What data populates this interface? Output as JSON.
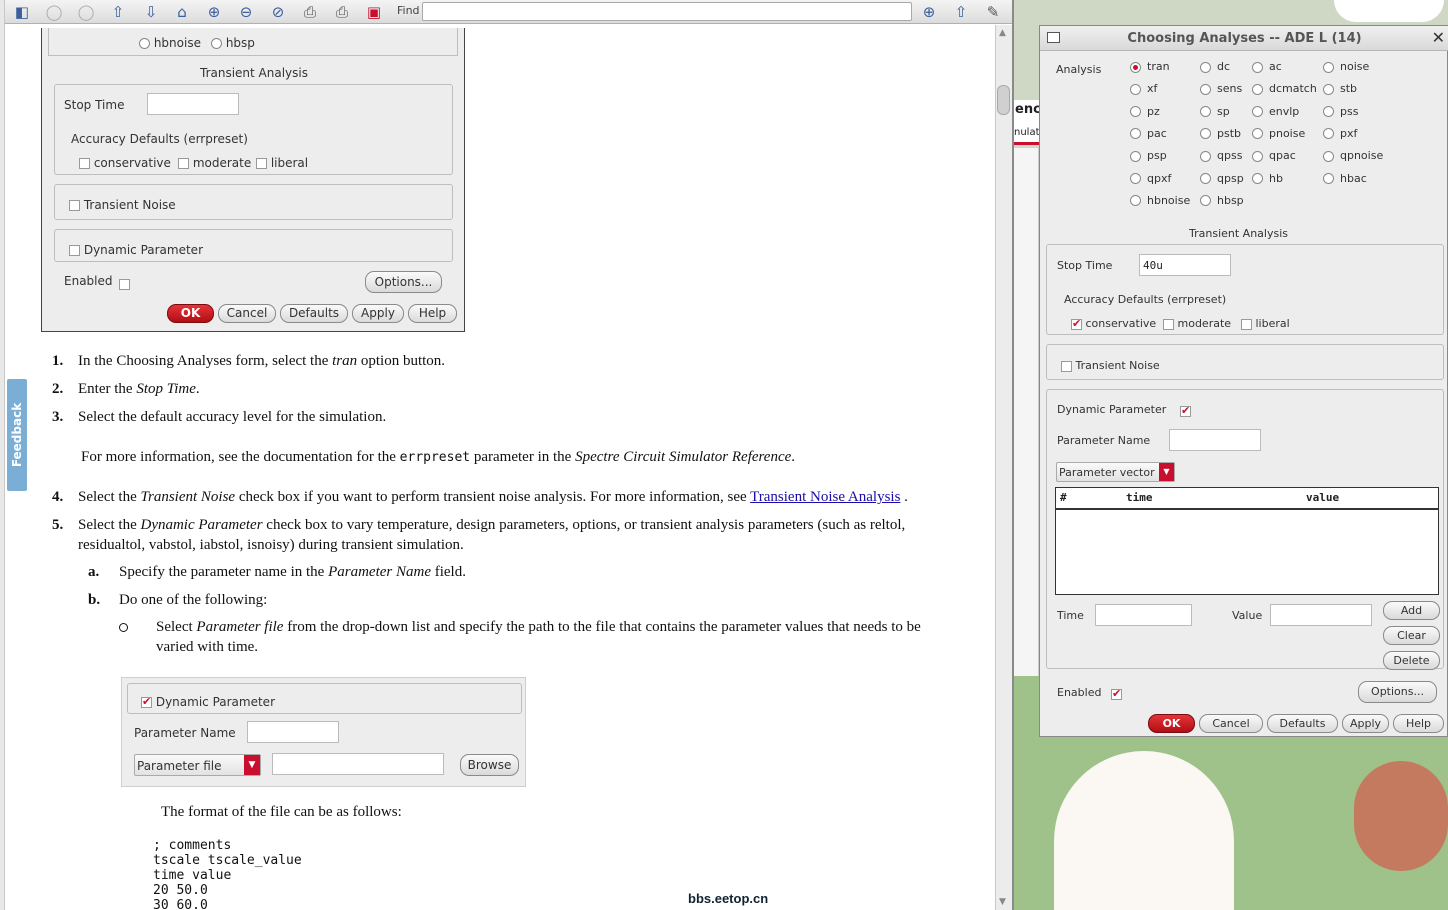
{
  "toolbar": {
    "find_label": "Find"
  },
  "feedback": {
    "label": "Feedback"
  },
  "form1": {
    "hb_options": [
      "hbnoise",
      "hbsp"
    ],
    "section_title": "Transient Analysis",
    "stop_time_label": "Stop Time",
    "stop_time_value": "",
    "accuracy_label": "Accuracy Defaults (errpreset)",
    "accuracy_options": [
      "conservative",
      "moderate",
      "liberal"
    ],
    "transient_noise": "Transient Noise",
    "dynamic_parameter": "Dynamic Parameter",
    "enabled_label": "Enabled",
    "options_button": "Options...",
    "buttons": [
      "OK",
      "Cancel",
      "Defaults",
      "Apply",
      "Help"
    ]
  },
  "doc": {
    "steps": [
      {
        "num": "1.",
        "parts": [
          "In the Choosing Analyses form, select the ",
          "tran",
          " option button."
        ]
      },
      {
        "num": "2.",
        "parts": [
          "Enter the ",
          "Stop Time",
          "."
        ]
      },
      {
        "num": "3.",
        "parts": [
          "Select the default accuracy level for the simulation."
        ]
      }
    ],
    "info": {
      "pre": "For more information, see the documentation for the ",
      "code": "errpreset",
      "mid": " parameter in the ",
      "italic": "Spectre Circuit Simulator Reference",
      "post": "."
    },
    "step4": {
      "num": "4.",
      "pre": "Select the ",
      "italic": "Transient Noise",
      "mid": " check box if you want to perform transient noise analysis. For more information, see ",
      "link": "Transient Noise Analysis",
      "post": " ."
    },
    "step5": {
      "num": "5.",
      "pre": "Select the ",
      "italic": "Dynamic Parameter",
      "line1": " check box to vary temperature, design parameters, options, or transient analysis parameters (such as reltol,",
      "line2": "residualtol, vabstol, iabstol, isnoisy) during transient simulation."
    },
    "sub_a": {
      "num": "a.",
      "pre": "Specify the parameter name in the ",
      "italic": "Parameter Name",
      "post": " field."
    },
    "sub_b": {
      "num": "b.",
      "text": "Do one of the following:"
    },
    "bullet": {
      "pre": "Select ",
      "italic": "Parameter file",
      "line1": " from the drop-down list and specify the path to the file that contains the parameter values that needs to be",
      "line2": "varied with time."
    },
    "format_text": "The format of the file can be as follows:",
    "code_lines": [
      "; comments",
      "tscale tscale_value",
      "time value",
      "20 50.0",
      "30 60.0"
    ],
    "watermark": "bbs.eetop.cn"
  },
  "form2": {
    "dynamic_parameter": "Dynamic Parameter",
    "parameter_name": "Parameter Name",
    "dropdown": "Parameter file",
    "browse": "Browse"
  },
  "partial_labels": [
    "enc",
    "nulat"
  ],
  "dialog": {
    "title": "Choosing Analyses -- ADE L (14)",
    "analysis_label": "Analysis",
    "analyses": [
      [
        "tran",
        "dc",
        "ac",
        "noise"
      ],
      [
        "xf",
        "sens",
        "dcmatch",
        "stb"
      ],
      [
        "pz",
        "sp",
        "envlp",
        "pss"
      ],
      [
        "pac",
        "pstb",
        "pnoise",
        "pxf"
      ],
      [
        "psp",
        "qpss",
        "qpac",
        "qpnoise"
      ],
      [
        "qpxf",
        "qpsp",
        "hb",
        "hbac"
      ],
      [
        "hbnoise",
        "hbsp",
        "",
        ""
      ]
    ],
    "selected_analysis": "tran",
    "section_title": "Transient Analysis",
    "stop_time_label": "Stop Time",
    "stop_time_value": "40u",
    "accuracy_label": "Accuracy Defaults (errpreset)",
    "accuracy_options": [
      "conservative",
      "moderate",
      "liberal"
    ],
    "accuracy_selected": "conservative",
    "transient_noise": "Transient Noise",
    "dynamic_parameter": "Dynamic Parameter",
    "parameter_name_label": "Parameter Name",
    "dropdown": "Parameter vector",
    "table_headers": [
      "#",
      "time",
      "value"
    ],
    "time_label": "Time",
    "value_label": "Value",
    "add": "Add",
    "clear": "Clear",
    "delete": "Delete",
    "enabled_label": "Enabled",
    "options_button": "Options...",
    "buttons": [
      "OK",
      "Cancel",
      "Defaults",
      "Apply",
      "Help"
    ]
  },
  "colors": {
    "accent_red": "#c8102e",
    "feedback_tab": "#7aaed4",
    "link": "#1a0dab"
  }
}
